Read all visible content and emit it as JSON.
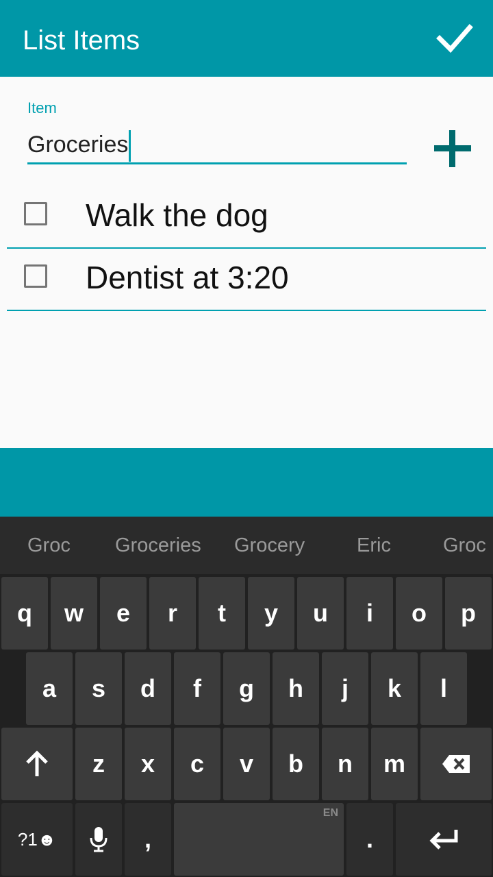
{
  "appbar": {
    "title": "List Items"
  },
  "form": {
    "label": "Item",
    "value": "Groceries"
  },
  "items": [
    {
      "text": "Walk the dog",
      "checked": false
    },
    {
      "text": "Dentist at 3:20",
      "checked": false
    }
  ],
  "keyboard": {
    "suggestions": [
      "Groc",
      "Groceries",
      "Grocery",
      "Eric",
      "Groc"
    ],
    "row1": [
      "q",
      "w",
      "e",
      "r",
      "t",
      "y",
      "u",
      "i",
      "o",
      "p"
    ],
    "row2": [
      "a",
      "s",
      "d",
      "f",
      "g",
      "h",
      "j",
      "k",
      "l"
    ],
    "row3": [
      "z",
      "x",
      "c",
      "v",
      "b",
      "n",
      "m"
    ],
    "symbols_label": "?1☻",
    "comma": ",",
    "period": ".",
    "language": "EN"
  },
  "colors": {
    "primary": "#0097a7",
    "accent": "#00a0b0",
    "add_icon": "#006b6e"
  }
}
